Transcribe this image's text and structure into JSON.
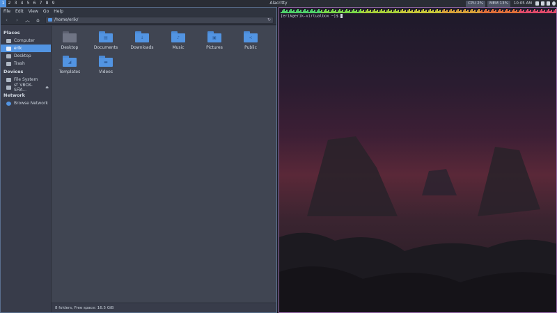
{
  "topbar": {
    "workspaces": [
      "1",
      "2",
      "3",
      "4",
      "5",
      "6",
      "7",
      "8",
      "9"
    ],
    "active_workspace": "1",
    "window_title": "Alacritty",
    "cpu": "CPU  2%",
    "mem": "MEM 13%",
    "clock": "10:05 AM",
    "tray_icons": [
      "battery-icon",
      "network-icon",
      "volume-icon",
      "power-icon"
    ]
  },
  "file_manager": {
    "menu": [
      "File",
      "Edit",
      "View",
      "Go",
      "Help"
    ],
    "path": "/home/erik/",
    "sidebar": {
      "places_label": "Places",
      "places": [
        {
          "label": "Computer",
          "icon": "computer-icon"
        },
        {
          "label": "erik",
          "icon": "home-icon",
          "selected": true
        },
        {
          "label": "Desktop",
          "icon": "desktop-icon"
        },
        {
          "label": "Trash",
          "icon": "trash-icon"
        }
      ],
      "devices_label": "Devices",
      "devices": [
        {
          "label": "File System",
          "icon": "drive-icon"
        },
        {
          "label": "sf_VBOX-SHA...",
          "icon": "drive-icon"
        }
      ],
      "network_label": "Network",
      "network": [
        {
          "label": "Browse Network",
          "icon": "network-icon"
        }
      ]
    },
    "files": [
      {
        "name": "Desktop",
        "glyph": "",
        "dark": true
      },
      {
        "name": "Documents",
        "glyph": "▤"
      },
      {
        "name": "Downloads",
        "glyph": "↓"
      },
      {
        "name": "Music",
        "glyph": "♪"
      },
      {
        "name": "Pictures",
        "glyph": "▣"
      },
      {
        "name": "Public",
        "glyph": "<"
      },
      {
        "name": "Templates",
        "glyph": "◢"
      },
      {
        "name": "Videos",
        "glyph": "▬"
      }
    ],
    "status": "8 folders, Free space: 16.5 GiB"
  },
  "terminal": {
    "prompt": "[erik@erik-virtualbox ~]$ "
  },
  "colors": {
    "accent": "#5294e2",
    "bg": "#383c4a",
    "terminal_border": "#9a6fb0"
  }
}
